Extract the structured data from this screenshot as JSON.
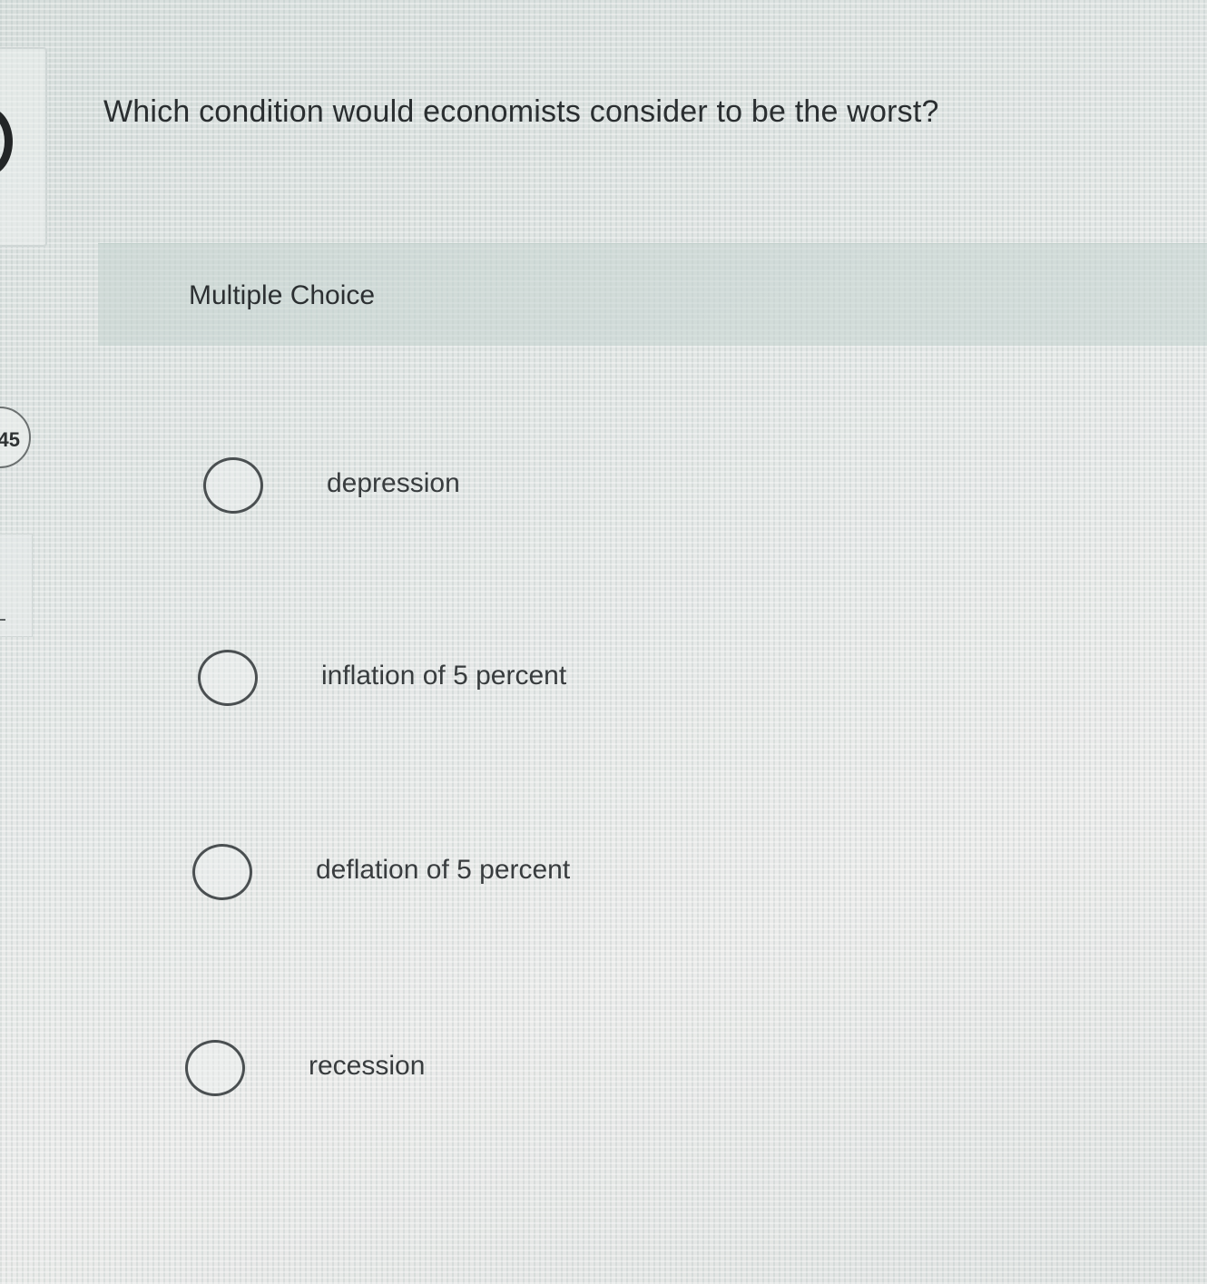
{
  "left_sidebar": {
    "badge_text": "45"
  },
  "question": {
    "text": "Which condition would economists consider to be the worst?"
  },
  "answer_section": {
    "type_label": "Multiple Choice",
    "choices": [
      {
        "label": "depression",
        "selected": false
      },
      {
        "label": "inflation of 5 percent",
        "selected": false
      },
      {
        "label": "deflation of 5 percent",
        "selected": false
      },
      {
        "label": "recession",
        "selected": false
      }
    ]
  }
}
